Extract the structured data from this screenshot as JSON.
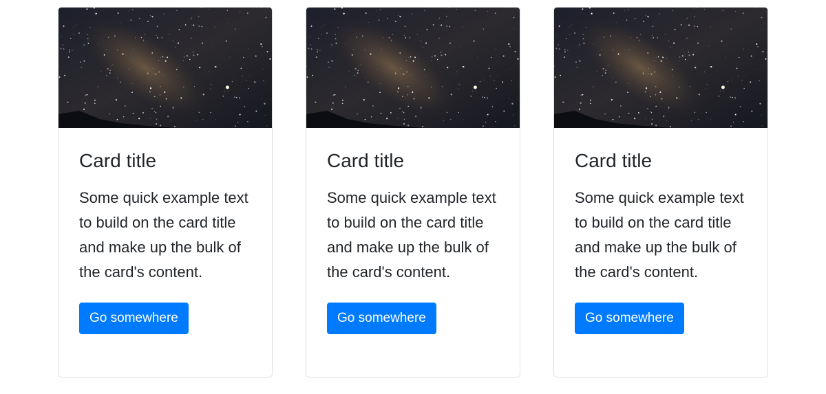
{
  "cards": [
    {
      "image_alt": "night sky milky way photo",
      "title": "Card title",
      "text": "Some quick example text to build on the card title and make up the bulk of the card's content.",
      "button_label": "Go somewhere"
    },
    {
      "image_alt": "night sky milky way photo",
      "title": "Card title",
      "text": "Some quick example text to build on the card title and make up the bulk of the card's content.",
      "button_label": "Go somewhere"
    },
    {
      "image_alt": "night sky milky way photo",
      "title": "Card title",
      "text": "Some quick example text to build on the card title and make up the bulk of the card's content.",
      "button_label": "Go somewhere"
    }
  ],
  "colors": {
    "button": "#007bff",
    "text": "#212529",
    "border": "#dfdfdf"
  }
}
